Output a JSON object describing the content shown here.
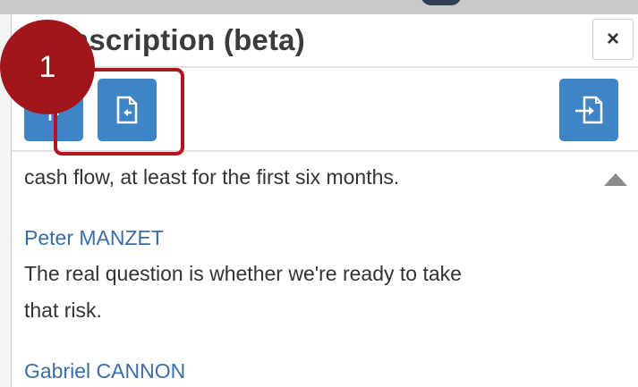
{
  "panel": {
    "title": "nscription (beta)",
    "close_label": "×"
  },
  "toolbar": {
    "buttons": [
      {
        "name": "speaker-toggle",
        "icon": "speaker-icon"
      },
      {
        "name": "export-transcript",
        "icon": "document-export-icon"
      },
      {
        "name": "share-transcript",
        "icon": "document-arrow-icon"
      }
    ]
  },
  "transcript": {
    "entries": [
      {
        "text": "cash flow, at least for the first six months."
      },
      {
        "speaker": "Peter MANZET",
        "lines": [
          "The real question is whether we're ready to take",
          "that risk."
        ]
      },
      {
        "speaker": "Gabriel CANNON"
      }
    ]
  },
  "annotation": {
    "step_number": "1"
  },
  "colors": {
    "button_blue": "#3f85c6",
    "speaker_blue": "#3a6ea5",
    "callout_red": "#a0161b"
  }
}
